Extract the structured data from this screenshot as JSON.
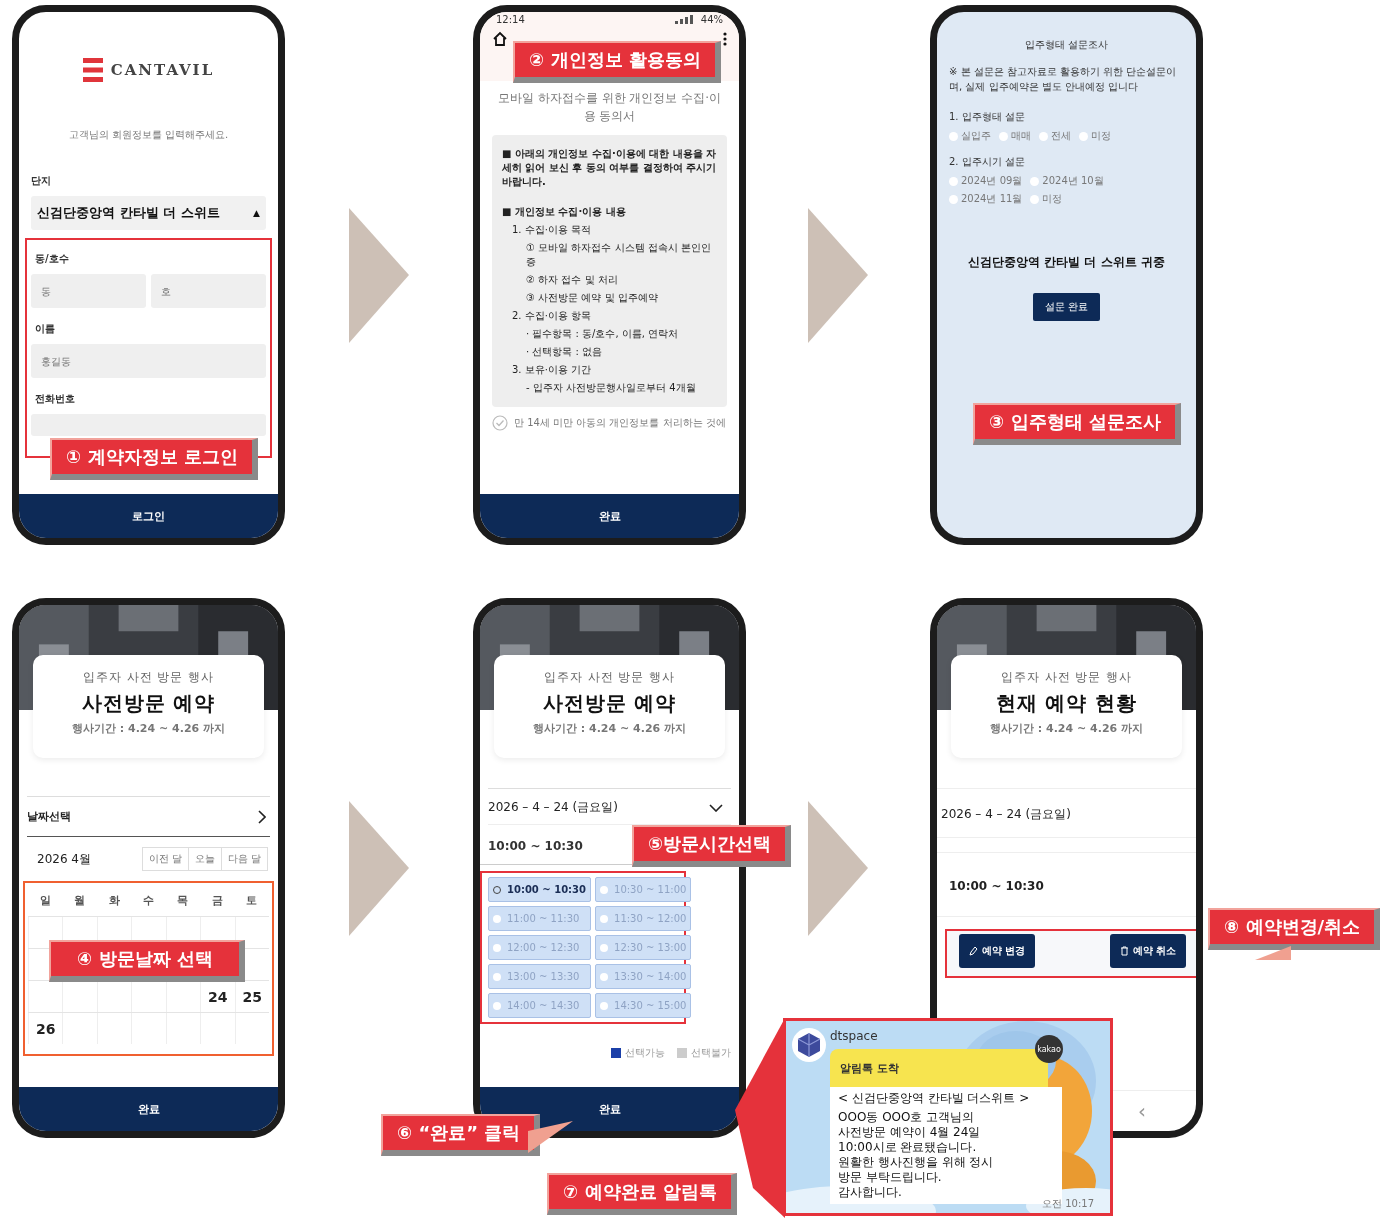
{
  "screens": [
    {
      "kind": "login",
      "logo": "CANTAVIL",
      "intro": "고객님의 회원정보를 입력해주세요.",
      "complex_label": "단지",
      "complex_value": "신검단중앙역 칸타빌 더 스위트",
      "caret": "▲",
      "unit_label": "동/호수",
      "dong_placeholder": "동",
      "ho_placeholder": "호",
      "name_label": "이름",
      "name_placeholder": "홍길동",
      "phone_label": "전화번호",
      "button": "로그인"
    },
    {
      "kind": "consent",
      "status_time": "12:14",
      "battery": "44%",
      "title": "모바일 하자접수를 위한 개인정보 수집·이용 동의서",
      "lines": [
        {
          "kind": "heading",
          "text": "■ 아래의 개인정보 수집·이용에 대한 내용을 자세히 읽어 보신 후 동의 여부를 결정하여 주시기 바랍니다."
        },
        {
          "kind": "heading",
          "text": "■ 개인정보 수집·이용 내용"
        },
        {
          "kind": "item",
          "text": "1. 수집·이용 목적"
        },
        {
          "kind": "sub",
          "text": "① 모바일 하자접수 시스템 접속시 본인인증"
        },
        {
          "kind": "sub",
          "text": "② 하자 접수 및 처리"
        },
        {
          "kind": "sub",
          "text": "③ 사전방문 예약 및 입주예약"
        },
        {
          "kind": "item",
          "text": "2. 수집·이용 항목"
        },
        {
          "kind": "sub",
          "text": "· 필수항목 : 동/호수, 이름, 연락처"
        },
        {
          "kind": "sub",
          "text": "· 선택항목 : 없음"
        },
        {
          "kind": "item",
          "text": "3. 보유·이용 기간"
        },
        {
          "kind": "sub",
          "text": "- 입주자 사전방문행사일로부터 4개월"
        }
      ],
      "agree": {
        "text": "만 14세 미만 아동의 개인정보를 처리하는 것에",
        "checked": false
      },
      "button": "완료"
    },
    {
      "kind": "survey",
      "title": "입주형태 설문조사",
      "notice": "※ 본 설문은 참고자료로 활용하기 위한 단순설문이며, 실제 입주예약은 별도 안내예정 입니다",
      "questions": [
        {
          "text": "1. 입주형태 설문",
          "options": [
            {
              "label": "실입주",
              "selected": false
            },
            {
              "label": "매매",
              "selected": false
            },
            {
              "label": "전세",
              "selected": false
            },
            {
              "label": "미정",
              "selected": false
            }
          ]
        },
        {
          "text": "2. 입주시기 설문",
          "options": [
            {
              "label": "2024년 09월",
              "selected": false
            },
            {
              "label": "2024년 10월",
              "selected": false
            },
            {
              "label": "2024년 11월",
              "selected": false
            },
            {
              "label": "미정",
              "selected": false
            }
          ]
        }
      ],
      "complex": "신검단중앙역 칸타빌 더 스위트 귀중",
      "button": "설문 완료"
    },
    {
      "kind": "date",
      "event": "입주자 사전 방문 행사",
      "title": "사전방문 예약",
      "period": "행사기간 : 4.24 ~ 4.26 까지",
      "date_label": "날짜선택",
      "month": "2026 4월",
      "nav": [
        "이전 달",
        "오늘",
        "다음 달"
      ],
      "weekdays": [
        "일",
        "월",
        "화",
        "수",
        "목",
        "금",
        "토"
      ],
      "weeks": [
        [
          "24",
          "25"
        ],
        [
          "26"
        ]
      ],
      "button": "완료"
    },
    {
      "kind": "time",
      "event": "입주자 사전 방문 행사",
      "title": "사전방문 예약",
      "period": "행사기간 : 4.24 ~ 4.26 까지",
      "date": "2026 – 4 – 24 (금요일)",
      "chosen": "10:00 ~ 10:30",
      "slots": [
        {
          "label": "10:00 ~ 10:30",
          "selected": true
        },
        {
          "label": "10:30 ~ 11:00",
          "selected": false
        },
        {
          "label": "11:00 ~ 11:30",
          "selected": false
        },
        {
          "label": "11:30 ~ 12:00",
          "selected": false
        },
        {
          "label": "12:00 ~ 12:30",
          "selected": false
        },
        {
          "label": "12:30 ~ 13:00",
          "selected": false
        },
        {
          "label": "13:00 ~ 13:30",
          "selected": false
        },
        {
          "label": "13:30 ~ 14:00",
          "selected": false
        },
        {
          "label": "14:00 ~ 14:30",
          "selected": false
        },
        {
          "label": "14:30 ~ 15:00",
          "selected": false
        }
      ],
      "legend": [
        {
          "label": "선택가능",
          "color": "#1b3fa8"
        },
        {
          "label": "선택불가",
          "color": "#cccccc"
        }
      ],
      "button": "완료"
    },
    {
      "kind": "status",
      "event": "입주자 사전 방문 행사",
      "title": "현재 예약 현황",
      "period": "행사기간 : 4.24 ~ 4.26 까지",
      "date": "2026 – 4 – 24 (금요일)",
      "time": "10:00 ~ 10:30",
      "actions": [
        {
          "kind": "edit",
          "label": "예약 변경"
        },
        {
          "kind": "delete",
          "label": "예약 취소"
        }
      ],
      "back": "‹"
    }
  ],
  "callouts": [
    "① 계약자정보 로그인",
    "② 개인정보 활용동의",
    "③ 입주형태 설문조사",
    "④ 방문날짜 선택",
    "⑤방문시간선택",
    "⑥ “완료” 클릭",
    "⑦ 예약완료 알림톡",
    "⑧ 예약변경/취소"
  ],
  "notification": {
    "sender": "dtspace",
    "badge": "kakao",
    "header": "알림톡 도착",
    "subject": "< 신검단중앙역 칸타빌 더스위트 >",
    "lines": [
      "OOO동 OOO호 고객님의",
      "사전방문 예약이 4월 24일",
      "10:00시로 완료됐습니다.",
      "원활한 행사진행을 위해 정시",
      "방문 부탁드립니다.",
      "감사합니다."
    ],
    "time": "오전 10:17"
  }
}
